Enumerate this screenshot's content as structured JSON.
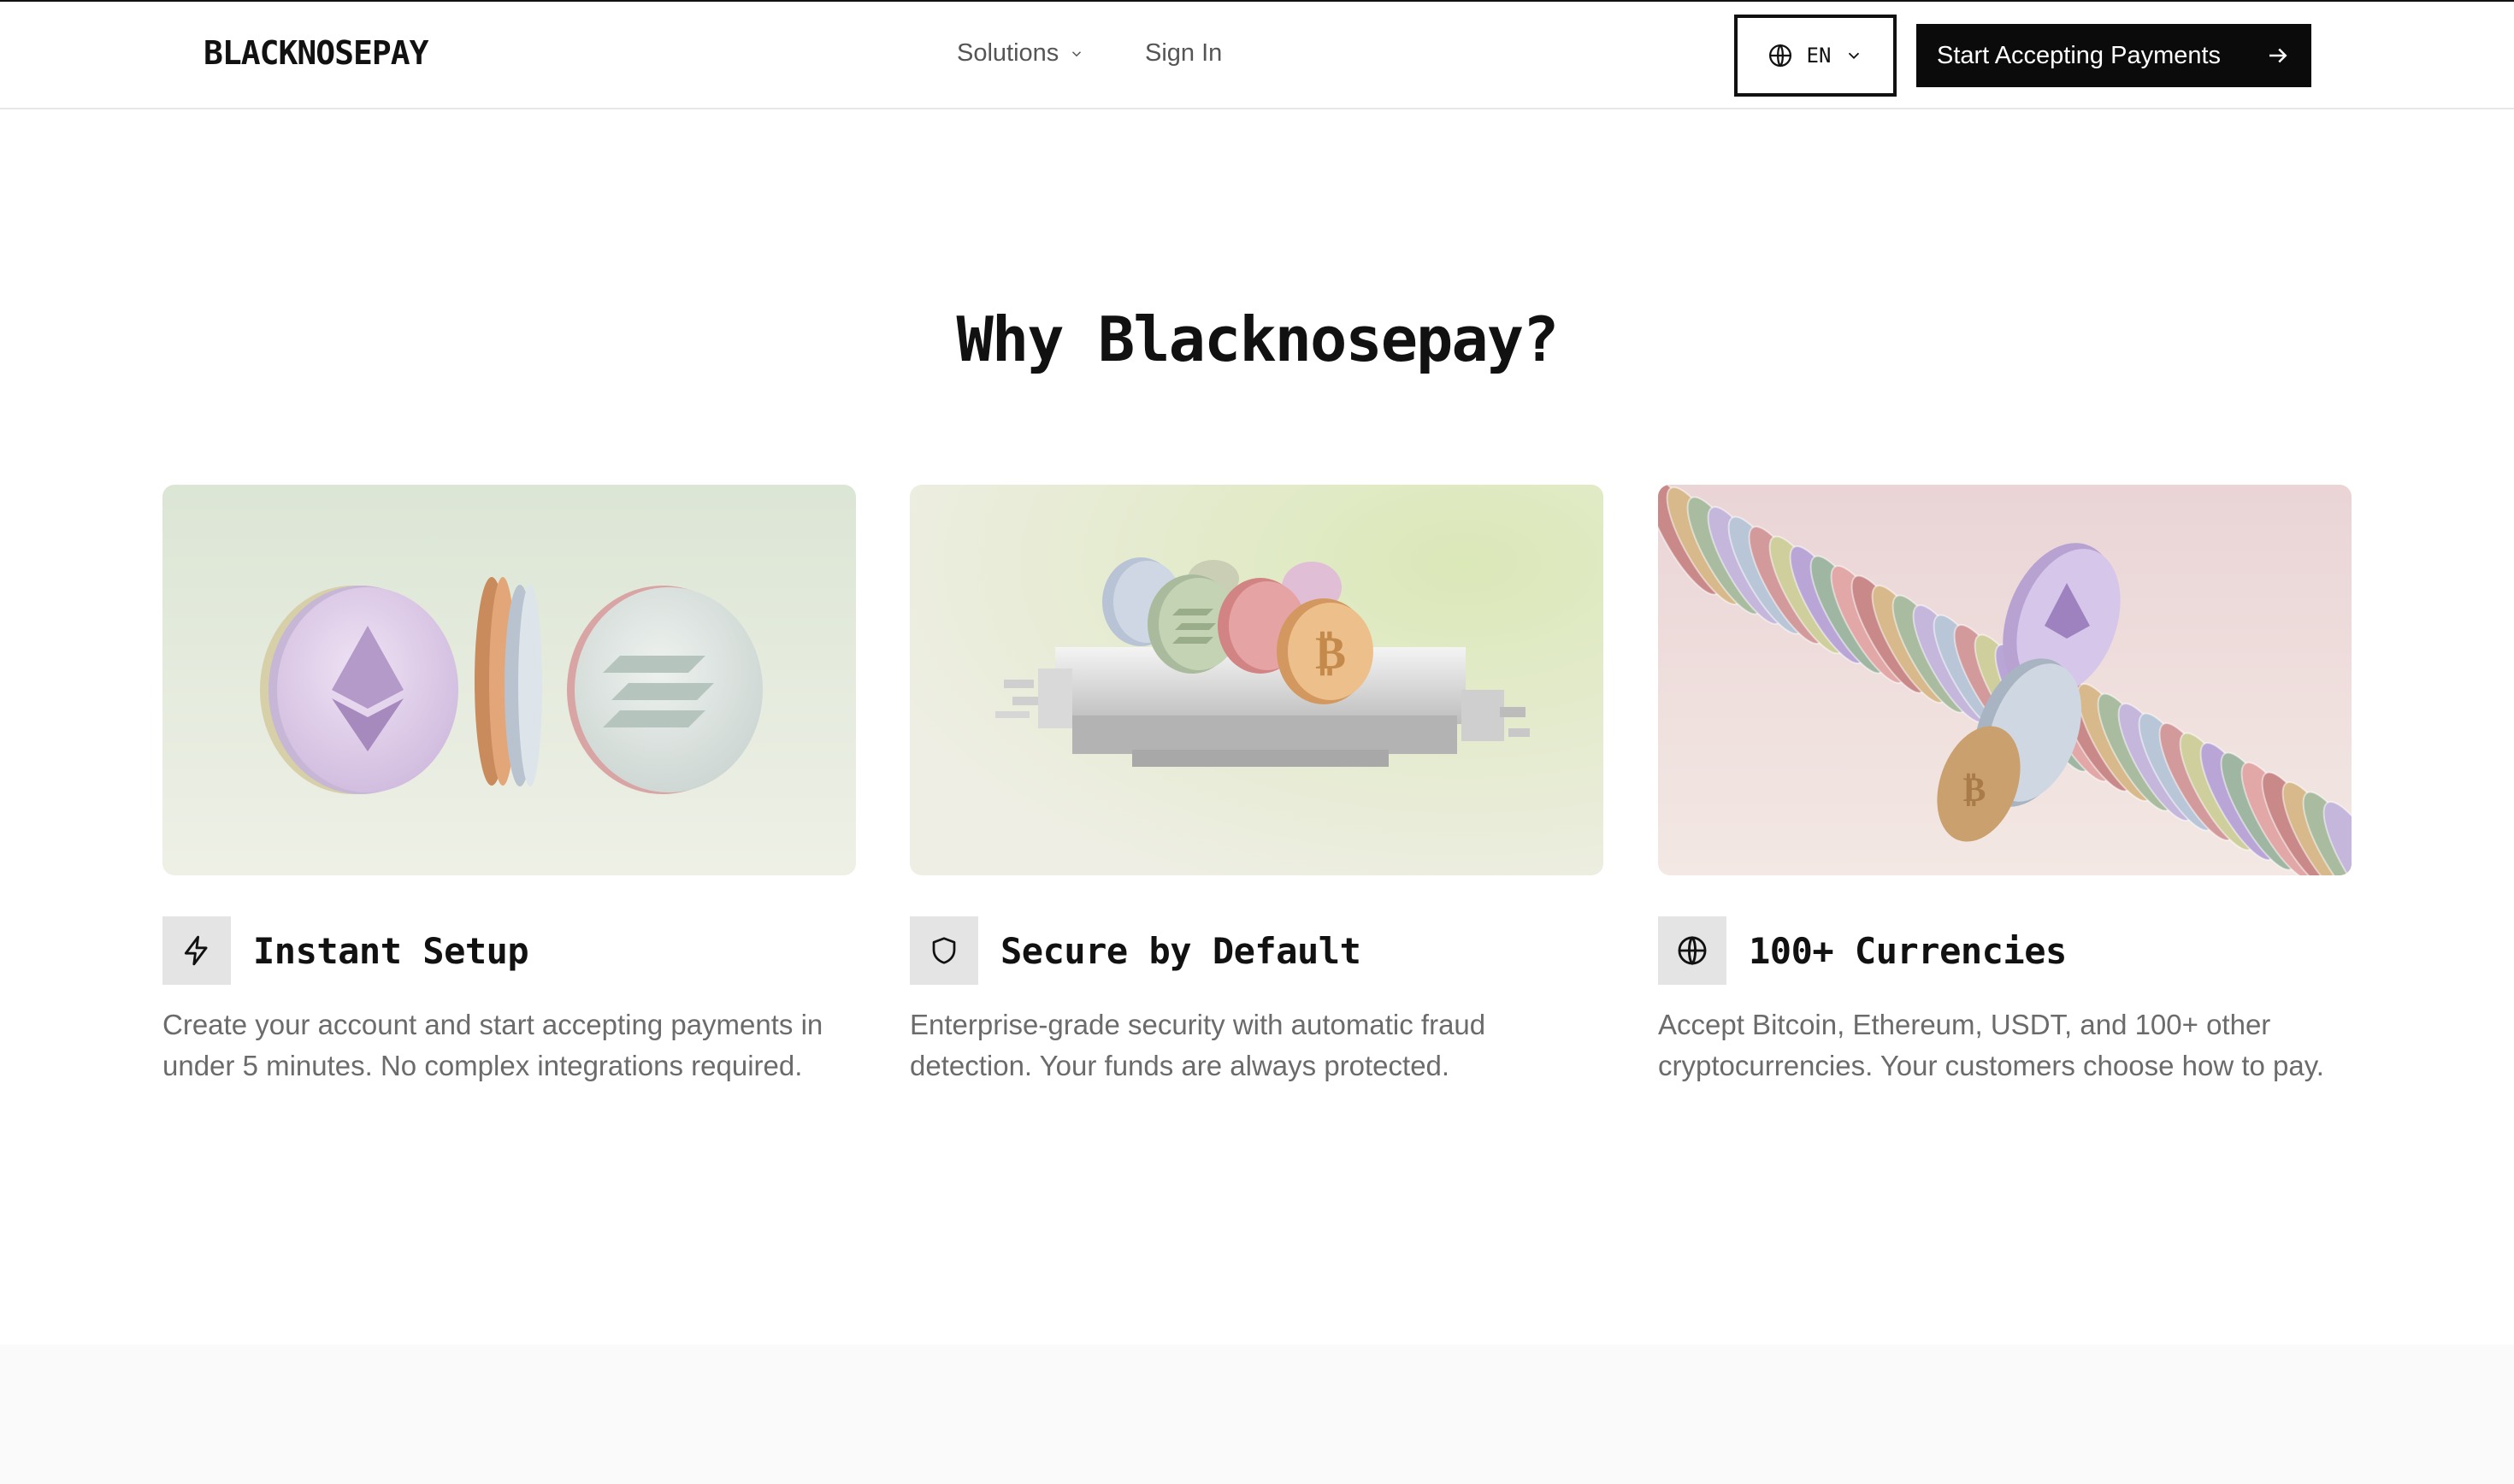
{
  "nav": {
    "logo": "BLACKNOSEPAY",
    "solutions_label": "Solutions",
    "signin_label": "Sign In",
    "language": "EN",
    "cta_label": "Start Accepting Payments"
  },
  "section": {
    "heading": "Why Blacknosepay?",
    "features": [
      {
        "icon": "lightning-icon",
        "title": "Instant Setup",
        "description": "Create your account and start accepting payments in under 5 minutes. No complex integrations required."
      },
      {
        "icon": "shield-icon",
        "title": "Secure by Default",
        "description": "Enterprise-grade security with automatic fraud detection. Your funds are always protected."
      },
      {
        "icon": "globe-icon",
        "title": "100+ Currencies",
        "description": "Accept Bitcoin, Ethereum, USDT, and 100+ other cryptocurrencies. Your customers choose how to pay."
      }
    ]
  },
  "colors": {
    "brand_dark": "#0b0b0b",
    "text_muted": "#6b6b6b",
    "icon_bg": "#e4e4e4",
    "card1_bg": "#dfe8d9",
    "card2_bg": "#e4ecc8",
    "card3_bg": "#f0dcdc"
  }
}
